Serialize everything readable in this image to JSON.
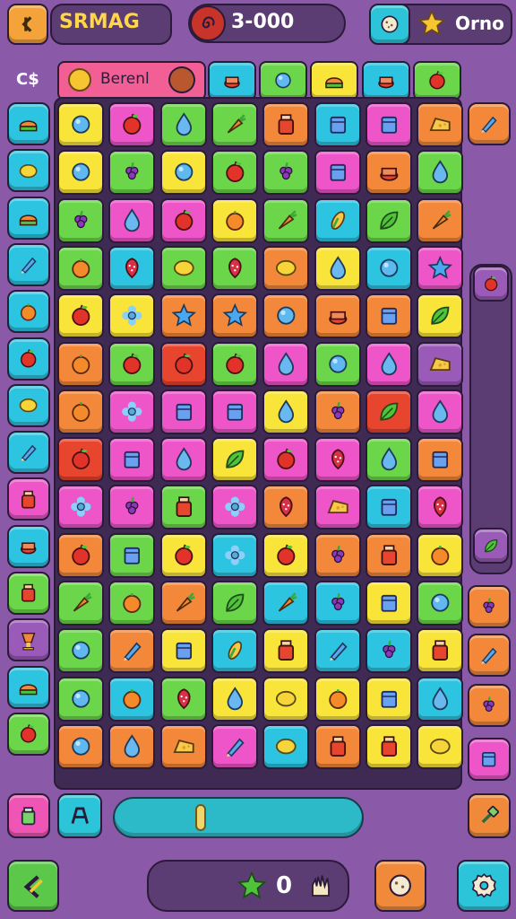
{
  "header": {
    "title": "SRMAG",
    "score_label": "3-000",
    "star_label": "Orno"
  },
  "board_header": {
    "currency": "C$",
    "label": "Berenl"
  },
  "bottom_bar": {
    "count": "0"
  },
  "colors": {
    "background": "#8a5aa8",
    "board": "#3e2a52",
    "accent": "#2cb9c8",
    "gold": "#f7c531"
  },
  "board": {
    "rows": [
      [
        "yellow:ball",
        "pink:apple",
        "green:drop",
        "green:carrot",
        "orange:jar",
        "cyan:box",
        "pink:box",
        "orange:cheese"
      ],
      [
        "yellow:ball",
        "green:grape",
        "yellow:ball",
        "green:apple",
        "green:grape",
        "pink:box",
        "orange:pot",
        "green:drop"
      ],
      [
        "green:grape",
        "pink:drop",
        "pink:apple",
        "yellow:orange",
        "green:carrot",
        "cyan:corn",
        "green:leaf",
        "orange:carrot"
      ],
      [
        "green:orange",
        "cyan:berry",
        "green:lemon",
        "green:berry",
        "orange:lemon",
        "yellow:drop",
        "cyan:ball",
        "pink:star"
      ],
      [
        "yellow:apple",
        "yellow:flower",
        "orange:star",
        "orange:star",
        "orange:ball",
        "orange:pot",
        "orange:box",
        "yellow:leaf"
      ],
      [
        "orange:orange",
        "green:apple",
        "red:apple",
        "green:apple",
        "pink:drop",
        "green:ball",
        "pink:drop",
        "purple:cheese"
      ],
      [
        "orange:orange",
        "pink:flower",
        "pink:box",
        "pink:box",
        "yellow:drop",
        "orange:grape",
        "red:leaf",
        "pink:drop"
      ],
      [
        "red:apple",
        "pink:box",
        "pink:drop",
        "yellow:leaf",
        "pink:apple",
        "pink:berry",
        "green:drop",
        "orange:box"
      ],
      [
        "pink:flower",
        "pink:grape",
        "green:jar",
        "pink:flower",
        "orange:berry",
        "pink:cheese",
        "cyan:box",
        "pink:berry"
      ],
      [
        "orange:apple",
        "green:box",
        "yellow:apple",
        "cyan:flower",
        "yellow:apple",
        "orange:grape",
        "orange:jar",
        "yellow:orange"
      ],
      [
        "green:carrot",
        "green:orange",
        "orange:carrot",
        "green:leaf",
        "cyan:carrot",
        "cyan:grape",
        "yellow:box",
        "green:ball"
      ],
      [
        "green:ball",
        "orange:pen",
        "yellow:box",
        "cyan:corn",
        "yellow:jar",
        "cyan:pen",
        "cyan:grape",
        "yellow:jar"
      ],
      [
        "green:ball",
        "cyan:orange",
        "green:berry",
        "yellow:drop",
        "yellow:lemon",
        "yellow:orange",
        "yellow:box",
        "cyan:drop"
      ],
      [
        "orange:ball",
        "orange:drop",
        "orange:cheese",
        "pink:pen",
        "cyan:lemon",
        "orange:jar",
        "yellow:jar",
        "yellow:lemon"
      ]
    ],
    "top_strip": [
      "cyan:pot",
      "green:ball",
      "yellow:cake",
      "cyan:pot",
      "green:apple"
    ],
    "left_column": [
      "cyan:cake",
      "cyan:lemon",
      "cyan:cake",
      "cyan:pen",
      "cyan:orange",
      "cyan:apple",
      "cyan:lemon",
      "cyan:pen",
      "pink:jar",
      "cyan:pot",
      "green:jar",
      "purple:cup",
      "cyan:cake",
      "green:apple"
    ],
    "right_items": [
      "orange:pen",
      "purple:apple",
      "purple:leaf",
      "orange:grape",
      "orange:pen",
      "orange:grape",
      "pink:box",
      "orange:leaf"
    ]
  }
}
